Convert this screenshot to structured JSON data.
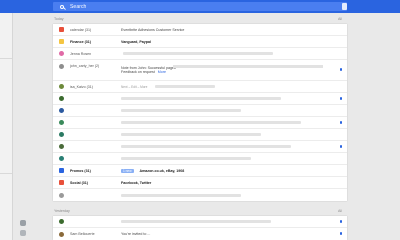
{
  "search": {
    "placeholder": "Search"
  },
  "sections": {
    "today_label": "Today",
    "yesterday_label": "Yesterday",
    "all_label": "All"
  },
  "today_rows": [
    {
      "sender": "calendar (31)",
      "subject": "Eventbrite Adhesions Customer Service",
      "avatar_color": "#e8503a",
      "blur_width": 0,
      "bold": false,
      "pinned": false
    },
    {
      "sender": "Finance (31)",
      "subject": "Vanguard, Paypal",
      "avatar_color": "#f4c542",
      "blur_width": 0,
      "bold": true,
      "pinned": false
    },
    {
      "sender": "Jenna Rosen",
      "subject": "",
      "avatar_color": "#e06aa6",
      "blur_width": 150,
      "bold": false,
      "pinned": false
    }
  ],
  "tall_row": {
    "sender": "john_carty_her (2)",
    "line1": "Note from John: Successful pages",
    "line2": "Feedback on request",
    "link": "More",
    "avatar_color": "#8e8e8e"
  },
  "row_isa": {
    "sender": "isa_Kaivo (31)",
    "chip": "Next – Edit – More",
    "avatar_color": "#6d8a3a"
  },
  "blur_rows": [
    {
      "avatar_color": "#3b6b2e",
      "blur_width": 160,
      "pinned": true
    },
    {
      "avatar_color": "#2c5aa0",
      "blur_width": 120,
      "pinned": false
    },
    {
      "avatar_color": "#3a8a5a",
      "blur_width": 180,
      "pinned": true
    },
    {
      "avatar_color": "#2b7a63",
      "blur_width": 140,
      "pinned": false
    },
    {
      "avatar_color": "#4a6b3a",
      "blur_width": 170,
      "pinned": true
    },
    {
      "avatar_color": "#2a7f74",
      "blur_width": 130,
      "pinned": false
    }
  ],
  "promos": {
    "sender": "Promos (31)",
    "chip": "1 new",
    "subject": "Amazon.co.uk, eBay, 1908",
    "avatar_color": "#2a64e0"
  },
  "social": {
    "sender": "Social (31)",
    "subject": "Facebook, Twitter",
    "avatar_color": "#e8503a"
  },
  "last_today": {
    "avatar_color": "#9a9a9a",
    "blur_width": 120
  },
  "yesterday_rows": [
    {
      "avatar_color": "#3b6b2e",
      "blur_width": 150
    },
    {
      "sender": "Sam Bellouerte",
      "subject": "You're invited to ...",
      "avatar_color": "#8a6a3a"
    }
  ]
}
